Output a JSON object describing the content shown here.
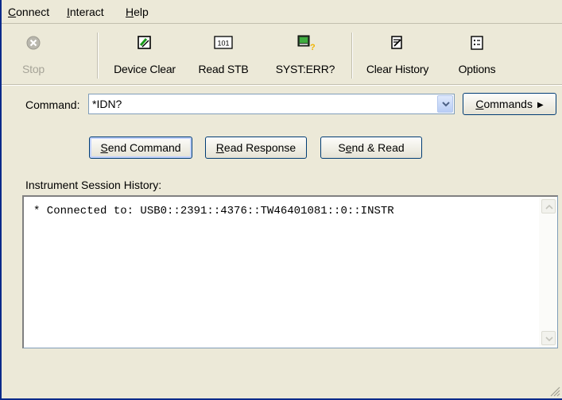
{
  "menu": {
    "connect": {
      "accel": "C",
      "rest": "onnect"
    },
    "interact": {
      "accel": "I",
      "rest": "nteract"
    },
    "help": {
      "accel": "H",
      "rest": "elp"
    }
  },
  "toolbar": {
    "stop": "Stop",
    "device_clear": "Device Clear",
    "read_stb": "Read STB",
    "read_stb_icon_text": "101",
    "syst_err": "SYST:ERR?",
    "clear_history": "Clear History",
    "options": "Options"
  },
  "command": {
    "label": "Command:",
    "value": "*IDN?",
    "commands_button": {
      "accel": "C",
      "rest": "ommands"
    }
  },
  "actions": {
    "send_command": {
      "accel": "S",
      "rest": "end Command"
    },
    "read_response": {
      "accel": "R",
      "rest": "ead Response"
    },
    "send_read": {
      "pre": "S",
      "accel": "e",
      "rest": "nd & Read"
    }
  },
  "history": {
    "label": "Instrument Session History:",
    "lines": [
      "* Connected to: USB0::2391::4376::TW46401081::0::INSTR"
    ]
  },
  "colors": {
    "window_bg": "#ece9d8",
    "frame_blue": "#0a246a",
    "button_border": "#003c74",
    "disabled_text": "#a6a498"
  }
}
